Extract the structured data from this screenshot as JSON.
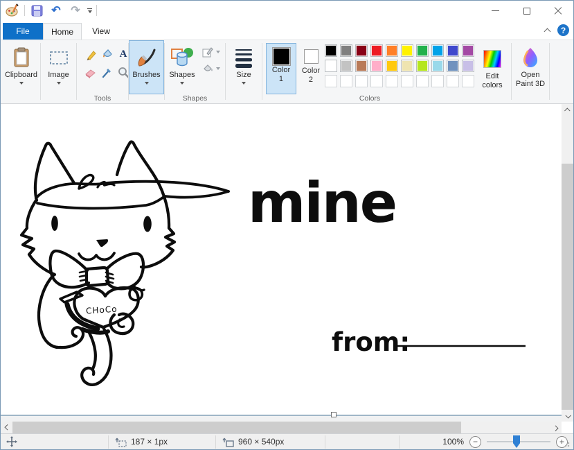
{
  "icons": {
    "undo": "↶",
    "redo": "↷",
    "help": "?",
    "text_tool": "A"
  },
  "tabs": {
    "file": "File",
    "home": "Home",
    "view": "View"
  },
  "ribbon": {
    "clipboard_label": "Clipboard",
    "image_label": "Image",
    "tools_label": "Tools",
    "brushes_label": "Brushes",
    "shapes_btn_label": "Shapes",
    "shapes_group_label": "Shapes",
    "size_label": "Size",
    "colors_group_label": "Colors",
    "color1_line1": "Color",
    "color1_line2": "1",
    "color2_line1": "Color",
    "color2_line2": "2",
    "edit_colors_line1": "Edit",
    "edit_colors_line2": "colors",
    "paint3d_line1": "Open",
    "paint3d_line2": "Paint 3D",
    "palette": [
      "#000000",
      "#7F7F7F",
      "#880015",
      "#ED1C24",
      "#FF7F27",
      "#FFF200",
      "#22B14C",
      "#00A2E8",
      "#3F48CC",
      "#A349A4",
      "#FFFFFF",
      "#C3C3C3",
      "#B97A57",
      "#FFAEC9",
      "#FFC90E",
      "#EFE4B0",
      "#B5E61D",
      "#99D9EA",
      "#7092BE",
      "#C8BFE7",
      null,
      null,
      null,
      null,
      null,
      null,
      null,
      null,
      null,
      null
    ]
  },
  "canvas": {
    "word": "mine",
    "from_label": "from:",
    "heart_text": "CHoCo"
  },
  "statusbar": {
    "selection_size": "187 × 1px",
    "image_size": "960 × 540px",
    "zoom_level": "100%"
  }
}
